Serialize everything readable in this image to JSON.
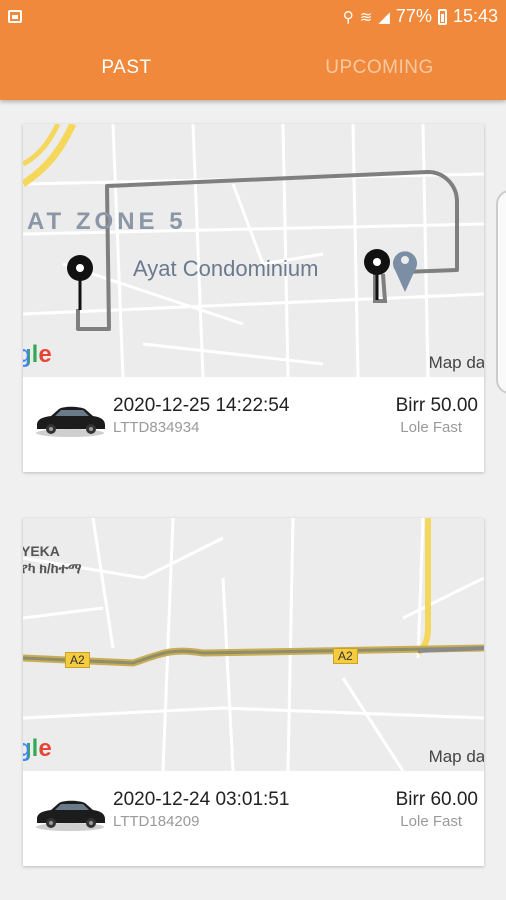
{
  "status_bar": {
    "battery_percent": "77%",
    "time": "15:43"
  },
  "tabs": [
    {
      "label": "PAST",
      "active": true
    },
    {
      "label": "UPCOMING",
      "active": false
    }
  ],
  "colors": {
    "accent": "#f0893b",
    "route": "#7f7f7f",
    "marker": "#111111",
    "highway": "#d6b64a"
  },
  "trips": [
    {
      "map": {
        "zone_label": "AT ZONE 5",
        "place_label": "Ayat Condominium",
        "google": "gle",
        "map_data": "Map dat"
      },
      "datetime": "2020-12-25 14:22:54",
      "code": "LTTD834934",
      "price": "Birr 50.00",
      "service": "Lole Fast"
    },
    {
      "map": {
        "area_label": "YEKA",
        "area_label_amharic": "የካ ክ/ከተማ",
        "road_label_1": "A2",
        "road_label_2": "A2",
        "google": "gle",
        "map_data": "Map dat"
      },
      "datetime": "2020-12-24 03:01:51",
      "code": "LTTD184209",
      "price": "Birr 60.00",
      "service": "Lole Fast"
    }
  ]
}
